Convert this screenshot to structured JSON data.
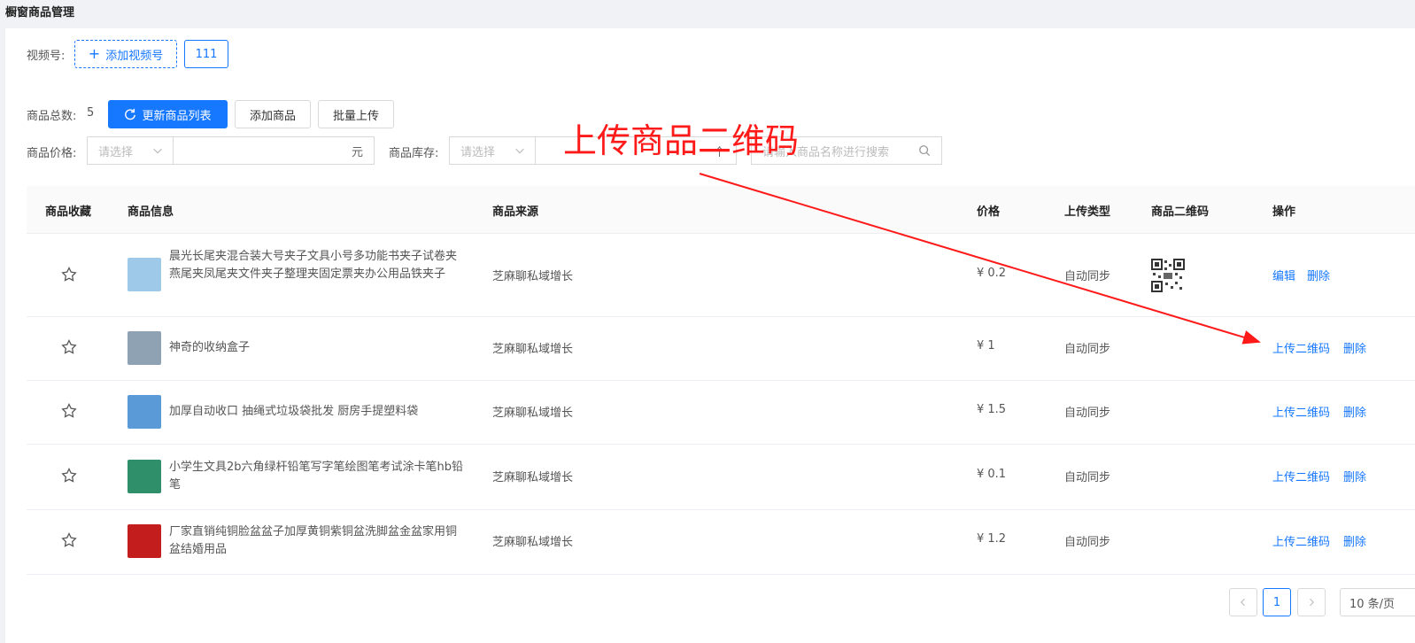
{
  "header": {
    "title": "橱窗商品管理"
  },
  "channel": {
    "label": "视频号:",
    "add_label": "添加视频号",
    "account": "111"
  },
  "toolbar": {
    "total_label": "商品总数:",
    "total_count": "5",
    "refresh_label": "更新商品列表",
    "add_label": "添加商品",
    "bulk_label": "批量上传"
  },
  "filters": {
    "price_label": "商品价格:",
    "price_select_placeholder": "请选择",
    "price_unit": "元",
    "stock_label": "商品库存:",
    "stock_select_placeholder": "请选择",
    "stock_unit": "个",
    "search_placeholder": "请输入商品名称进行搜索"
  },
  "table": {
    "columns": [
      "商品收藏",
      "商品信息",
      "商品来源",
      "价格",
      "上传类型",
      "商品二维码",
      "操作"
    ],
    "rows": [
      {
        "name": "晨光长尾夹混合装大号夹子文具小号多功能书夹子试卷夹燕尾夹凤尾夹文件夹子整理夹固定票夹办公用品铁夹子",
        "source": "芝麻聊私域增长",
        "price": "¥ 0.2",
        "upload_type": "自动同步",
        "has_qr": true,
        "action1": "编辑",
        "action2": "删除",
        "thumb_color": "#9ec9e8"
      },
      {
        "name": "神奇的收纳盒子",
        "source": "芝麻聊私域增长",
        "price": "¥ 1",
        "upload_type": "自动同步",
        "has_qr": false,
        "action1": "上传二维码",
        "action2": "删除",
        "thumb_color": "#8fa2b3"
      },
      {
        "name": "加厚自动收口 抽绳式垃圾袋批发 厨房手提塑料袋",
        "source": "芝麻聊私域增长",
        "price": "¥ 1.5",
        "upload_type": "自动同步",
        "has_qr": false,
        "action1": "上传二维码",
        "action2": "删除",
        "thumb_color": "#5a9ad6"
      },
      {
        "name": "小学生文具2b六角绿杆铅笔写字笔绘图笔考试涂卡笔hb铅笔",
        "source": "芝麻聊私域增长",
        "price": "¥ 0.1",
        "upload_type": "自动同步",
        "has_qr": false,
        "action1": "上传二维码",
        "action2": "删除",
        "thumb_color": "#2f8f6a"
      },
      {
        "name": "厂家直销纯铜脸盆盆子加厚黄铜紫铜盆洗脚盆金盆家用铜盆结婚用品",
        "source": "芝麻聊私域增长",
        "price": "¥ 1.2",
        "upload_type": "自动同步",
        "has_qr": false,
        "action1": "上传二维码",
        "action2": "删除",
        "thumb_color": "#c41d1d"
      }
    ]
  },
  "pagination": {
    "current": "1",
    "page_size": "10 条/页"
  },
  "annotation": {
    "text": "上传商品二维码"
  },
  "colors": {
    "primary": "#1677ff",
    "annotation": "#ff1a1a"
  }
}
